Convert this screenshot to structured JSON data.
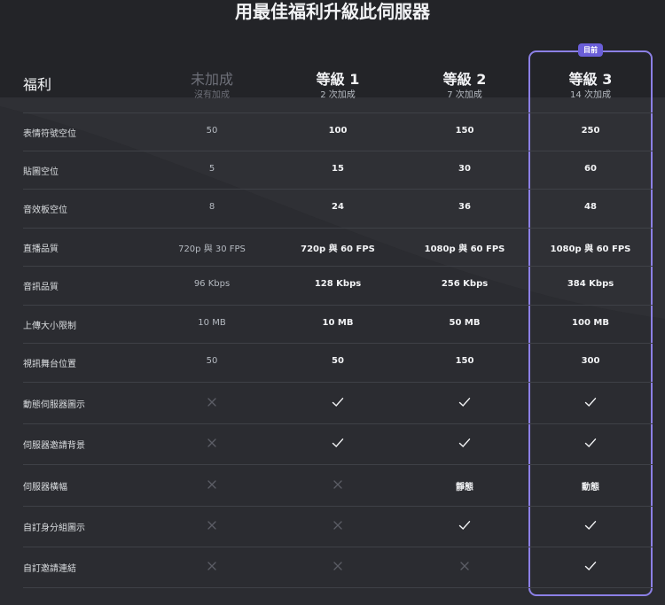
{
  "title": "用最佳福利升級此伺服器",
  "current_badge": "目前",
  "header": {
    "perk_label": "福利",
    "tiers": [
      {
        "name": "未加成",
        "sub": "沒有加成"
      },
      {
        "name": "等級 1",
        "sub": "2 次加成"
      },
      {
        "name": "等級 2",
        "sub": "7 次加成"
      },
      {
        "name": "等級 3",
        "sub": "14 次加成"
      }
    ]
  },
  "rows": [
    {
      "label": "表情符號空位",
      "values": [
        "50",
        "100",
        "150",
        "250"
      ]
    },
    {
      "label": "貼圖空位",
      "values": [
        "5",
        "15",
        "30",
        "60"
      ]
    },
    {
      "label": "音效板空位",
      "values": [
        "8",
        "24",
        "36",
        "48"
      ]
    },
    {
      "label": "直播品質",
      "values": [
        "720p 與 30 FPS",
        "720p 與 60 FPS",
        "1080p 與 60 FPS",
        "1080p 與 60 FPS"
      ]
    },
    {
      "label": "音訊品質",
      "values": [
        "96 Kbps",
        "128 Kbps",
        "256 Kbps",
        "384 Kbps"
      ]
    },
    {
      "label": "上傳大小限制",
      "values": [
        "10 MB",
        "10 MB",
        "50 MB",
        "100 MB"
      ]
    },
    {
      "label": "視訊舞台位置",
      "values": [
        "50",
        "50",
        "150",
        "300"
      ]
    },
    {
      "label": "動態伺服器圖示",
      "values": [
        "x-icon",
        "check-icon",
        "check-icon",
        "check-icon"
      ]
    },
    {
      "label": "伺服器邀請背景",
      "values": [
        "x-icon",
        "check-icon",
        "check-icon",
        "check-icon"
      ]
    },
    {
      "label": "伺服器橫幅",
      "values": [
        "x-icon",
        "x-icon",
        "靜態",
        "動態"
      ]
    },
    {
      "label": "自訂身分組圖示",
      "values": [
        "x-icon",
        "x-icon",
        "check-icon",
        "check-icon"
      ]
    },
    {
      "label": "自訂邀請連結",
      "values": [
        "x-icon",
        "x-icon",
        "x-icon",
        "check-icon"
      ]
    }
  ]
}
